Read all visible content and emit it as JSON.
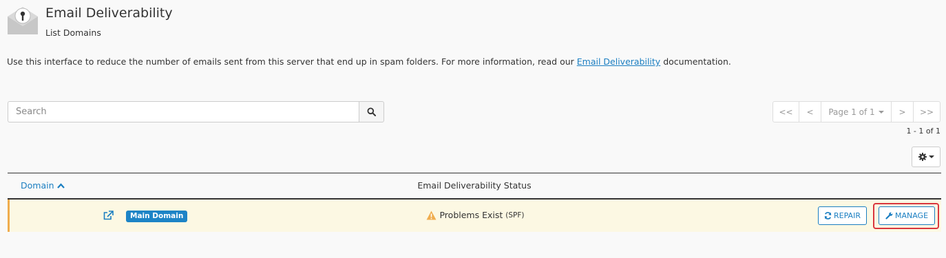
{
  "header": {
    "title": "Email Deliverability",
    "subtitle": "List Domains",
    "icon": "envelope-key-icon"
  },
  "intro": {
    "text_before": "Use this interface to reduce the number of emails sent from this server that end up in spam folders. For more information, read our ",
    "link_text": "Email Deliverability",
    "text_after": " documentation."
  },
  "search": {
    "placeholder": "Search",
    "value": "",
    "button_icon": "search-icon"
  },
  "pagination": {
    "first": "<<",
    "prev": "<",
    "page_label": "Page 1 of 1",
    "next": ">",
    "last": ">>",
    "range": "1 - 1 of 1"
  },
  "settings": {
    "icon": "gear-icon"
  },
  "table": {
    "columns": [
      {
        "label": "Domain",
        "sort": "ascending"
      },
      {
        "label": "Email Deliverability Status"
      }
    ],
    "rows": [
      {
        "domain": "",
        "badge": "Main Domain",
        "status": "Problems Exist",
        "status_detail": "(SPF)",
        "repair_label": "REPAIR",
        "manage_label": "MANAGE"
      }
    ]
  },
  "colors": {
    "link": "#1a7ec1",
    "badge": "#1d84c6",
    "warning_row": "#fcf8e3",
    "warning_border": "#f0ad4e",
    "highlight": "#d9363e"
  }
}
